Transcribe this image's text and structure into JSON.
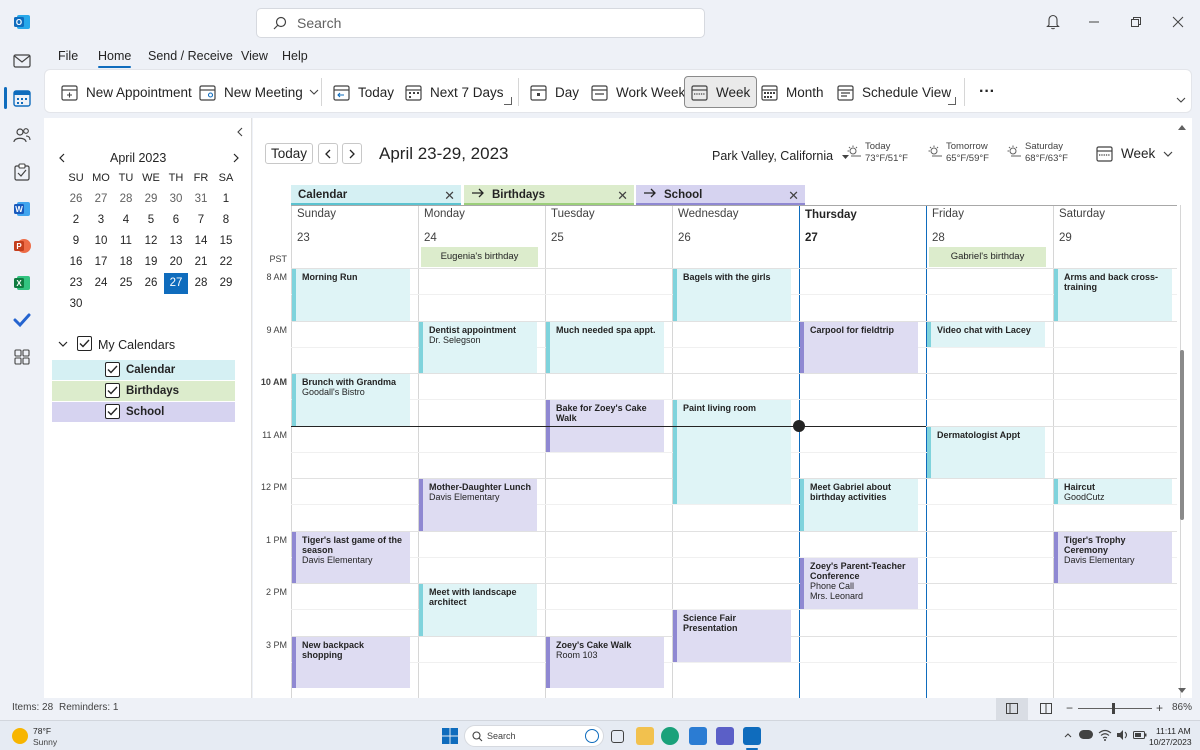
{
  "titlebar": {
    "search_placeholder": "Search"
  },
  "menu": {
    "file": "File",
    "home": "Home",
    "send_receive": "Send / Receive",
    "view": "View",
    "help": "Help"
  },
  "ribbon": {
    "new_appointment": "New Appointment",
    "new_meeting": "New Meeting",
    "today": "Today",
    "next7": "Next 7 Days",
    "day": "Day",
    "work_week": "Work Week",
    "week": "Week",
    "month": "Month",
    "schedule_view": "Schedule View",
    "more": "···"
  },
  "mini_calendar": {
    "title": "April 2023",
    "weekdays": [
      "SU",
      "MO",
      "TU",
      "WE",
      "TH",
      "FR",
      "SA"
    ],
    "weeks": [
      [
        "26",
        "27",
        "28",
        "29",
        "30",
        "31",
        "1"
      ],
      [
        "2",
        "3",
        "4",
        "5",
        "6",
        "7",
        "8"
      ],
      [
        "9",
        "10",
        "11",
        "12",
        "13",
        "14",
        "15"
      ],
      [
        "16",
        "17",
        "18",
        "19",
        "20",
        "21",
        "22"
      ],
      [
        "23",
        "24",
        "25",
        "26",
        "27",
        "28",
        "29"
      ],
      [
        "30"
      ]
    ]
  },
  "my_calendars": {
    "header": "My Calendars",
    "items": [
      {
        "label": "Calendar",
        "color": "#d5f0f3"
      },
      {
        "label": "Birthdays",
        "color": "#dceccc"
      },
      {
        "label": "School",
        "color": "#d6d3f0"
      }
    ]
  },
  "main": {
    "today_btn": "Today",
    "range_title": "April 23-29, 2023",
    "location": "Park Valley, California",
    "weather": [
      {
        "label": "Today",
        "temps": "73°F/51°F"
      },
      {
        "label": "Tomorrow",
        "temps": "65°F/59°F"
      },
      {
        "label": "Saturday",
        "temps": "68°F/63°F"
      }
    ],
    "view_label": "Week",
    "timezone": "PST",
    "tabs": [
      {
        "label": "Calendar",
        "color": "#d5f0f3"
      },
      {
        "label": "Birthdays",
        "color": "#dceccc"
      },
      {
        "label": "School",
        "color": "#d6d3f0"
      }
    ],
    "days": [
      {
        "name": "Sunday",
        "num": "23"
      },
      {
        "name": "Monday",
        "num": "24"
      },
      {
        "name": "Tuesday",
        "num": "25"
      },
      {
        "name": "Wednesday",
        "num": "26"
      },
      {
        "name": "Thursday",
        "num": "27"
      },
      {
        "name": "Friday",
        "num": "28"
      },
      {
        "name": "Saturday",
        "num": "29"
      }
    ],
    "hours": [
      "8 AM",
      "9 AM",
      "10 AM",
      "11 AM",
      "12 PM",
      "1 PM",
      "2 PM",
      "3 PM"
    ],
    "all_day": [
      {
        "day": 1,
        "title": "Eugenia's birthday"
      },
      {
        "day": 5,
        "title": "Gabriel's birthday"
      }
    ],
    "events": [
      {
        "day": 0,
        "start": 8.0,
        "end": 9.0,
        "cal": "cal",
        "title": "Morning Run",
        "detail": ""
      },
      {
        "day": 0,
        "start": 10.0,
        "end": 11.0,
        "cal": "cal",
        "title": "Brunch with Grandma",
        "detail": "Goodall's Bistro"
      },
      {
        "day": 0,
        "start": 13.0,
        "end": 14.0,
        "cal": "sch",
        "title": "Tiger's last game of the season",
        "detail": "Davis Elementary"
      },
      {
        "day": 0,
        "start": 15.0,
        "end": 16.0,
        "cal": "sch",
        "title": "New backpack shopping",
        "detail": ""
      },
      {
        "day": 1,
        "start": 9.0,
        "end": 10.0,
        "cal": "cal",
        "title": "Dentist appointment",
        "detail": "Dr. Selegson"
      },
      {
        "day": 1,
        "start": 12.0,
        "end": 13.0,
        "cal": "sch",
        "title": "Mother-Daughter Lunch",
        "detail": "Davis Elementary"
      },
      {
        "day": 1,
        "start": 14.0,
        "end": 15.0,
        "cal": "cal",
        "title": "Meet with landscape architect",
        "detail": ""
      },
      {
        "day": 2,
        "start": 9.0,
        "end": 10.0,
        "cal": "cal",
        "title": "Much needed spa appt.",
        "detail": ""
      },
      {
        "day": 2,
        "start": 10.5,
        "end": 11.5,
        "cal": "sch",
        "title": "Bake for Zoey's Cake Walk",
        "detail": ""
      },
      {
        "day": 2,
        "start": 15.0,
        "end": 16.0,
        "cal": "sch",
        "title": "Zoey's Cake Walk",
        "detail": "Room 103"
      },
      {
        "day": 3,
        "start": 8.0,
        "end": 9.0,
        "cal": "cal",
        "title": "Bagels with the girls",
        "detail": ""
      },
      {
        "day": 3,
        "start": 10.5,
        "end": 12.5,
        "cal": "cal",
        "title": "Paint living room",
        "detail": ""
      },
      {
        "day": 3,
        "start": 14.5,
        "end": 15.5,
        "cal": "sch",
        "title": "Science Fair Presentation",
        "detail": ""
      },
      {
        "day": 4,
        "start": 9.0,
        "end": 10.0,
        "cal": "sch",
        "title": "Carpool for fieldtrip",
        "detail": ""
      },
      {
        "day": 4,
        "start": 12.0,
        "end": 13.0,
        "cal": "cal",
        "title": "Meet Gabriel about birthday activities",
        "detail": ""
      },
      {
        "day": 4,
        "start": 13.5,
        "end": 14.5,
        "cal": "sch",
        "title": "Zoey's Parent-Teacher Conference",
        "detail": "Phone Call\nMrs. Leonard"
      },
      {
        "day": 5,
        "start": 9.0,
        "end": 9.5,
        "cal": "cal",
        "title": "Video chat with Lacey",
        "detail": ""
      },
      {
        "day": 5,
        "start": 11.0,
        "end": 12.0,
        "cal": "cal",
        "title": "Dermatologist Appt",
        "detail": ""
      },
      {
        "day": 6,
        "start": 8.0,
        "end": 9.0,
        "cal": "cal",
        "title": "Arms and back cross-training",
        "detail": ""
      },
      {
        "day": 6,
        "start": 12.0,
        "end": 12.5,
        "cal": "cal",
        "title": "Haircut",
        "detail": "GoodCutz"
      },
      {
        "day": 6,
        "start": 13.0,
        "end": 14.0,
        "cal": "sch",
        "title": "Tiger's Trophy Ceremony",
        "detail": "Davis Elementary"
      }
    ],
    "now_time": 11.0
  },
  "status": {
    "items": "Items: 28",
    "reminders": "Reminders: 1",
    "zoom": "86%"
  },
  "taskbar": {
    "weather_temp": "78°F",
    "weather_cond": "Sunny",
    "search": "Search",
    "time": "11:11 AM",
    "date": "10/27/2023"
  },
  "colors": {
    "accent": "#0f6cbd",
    "calendar": "#dff4f6",
    "school": "#dedcf2",
    "birthday": "#dceccc"
  }
}
